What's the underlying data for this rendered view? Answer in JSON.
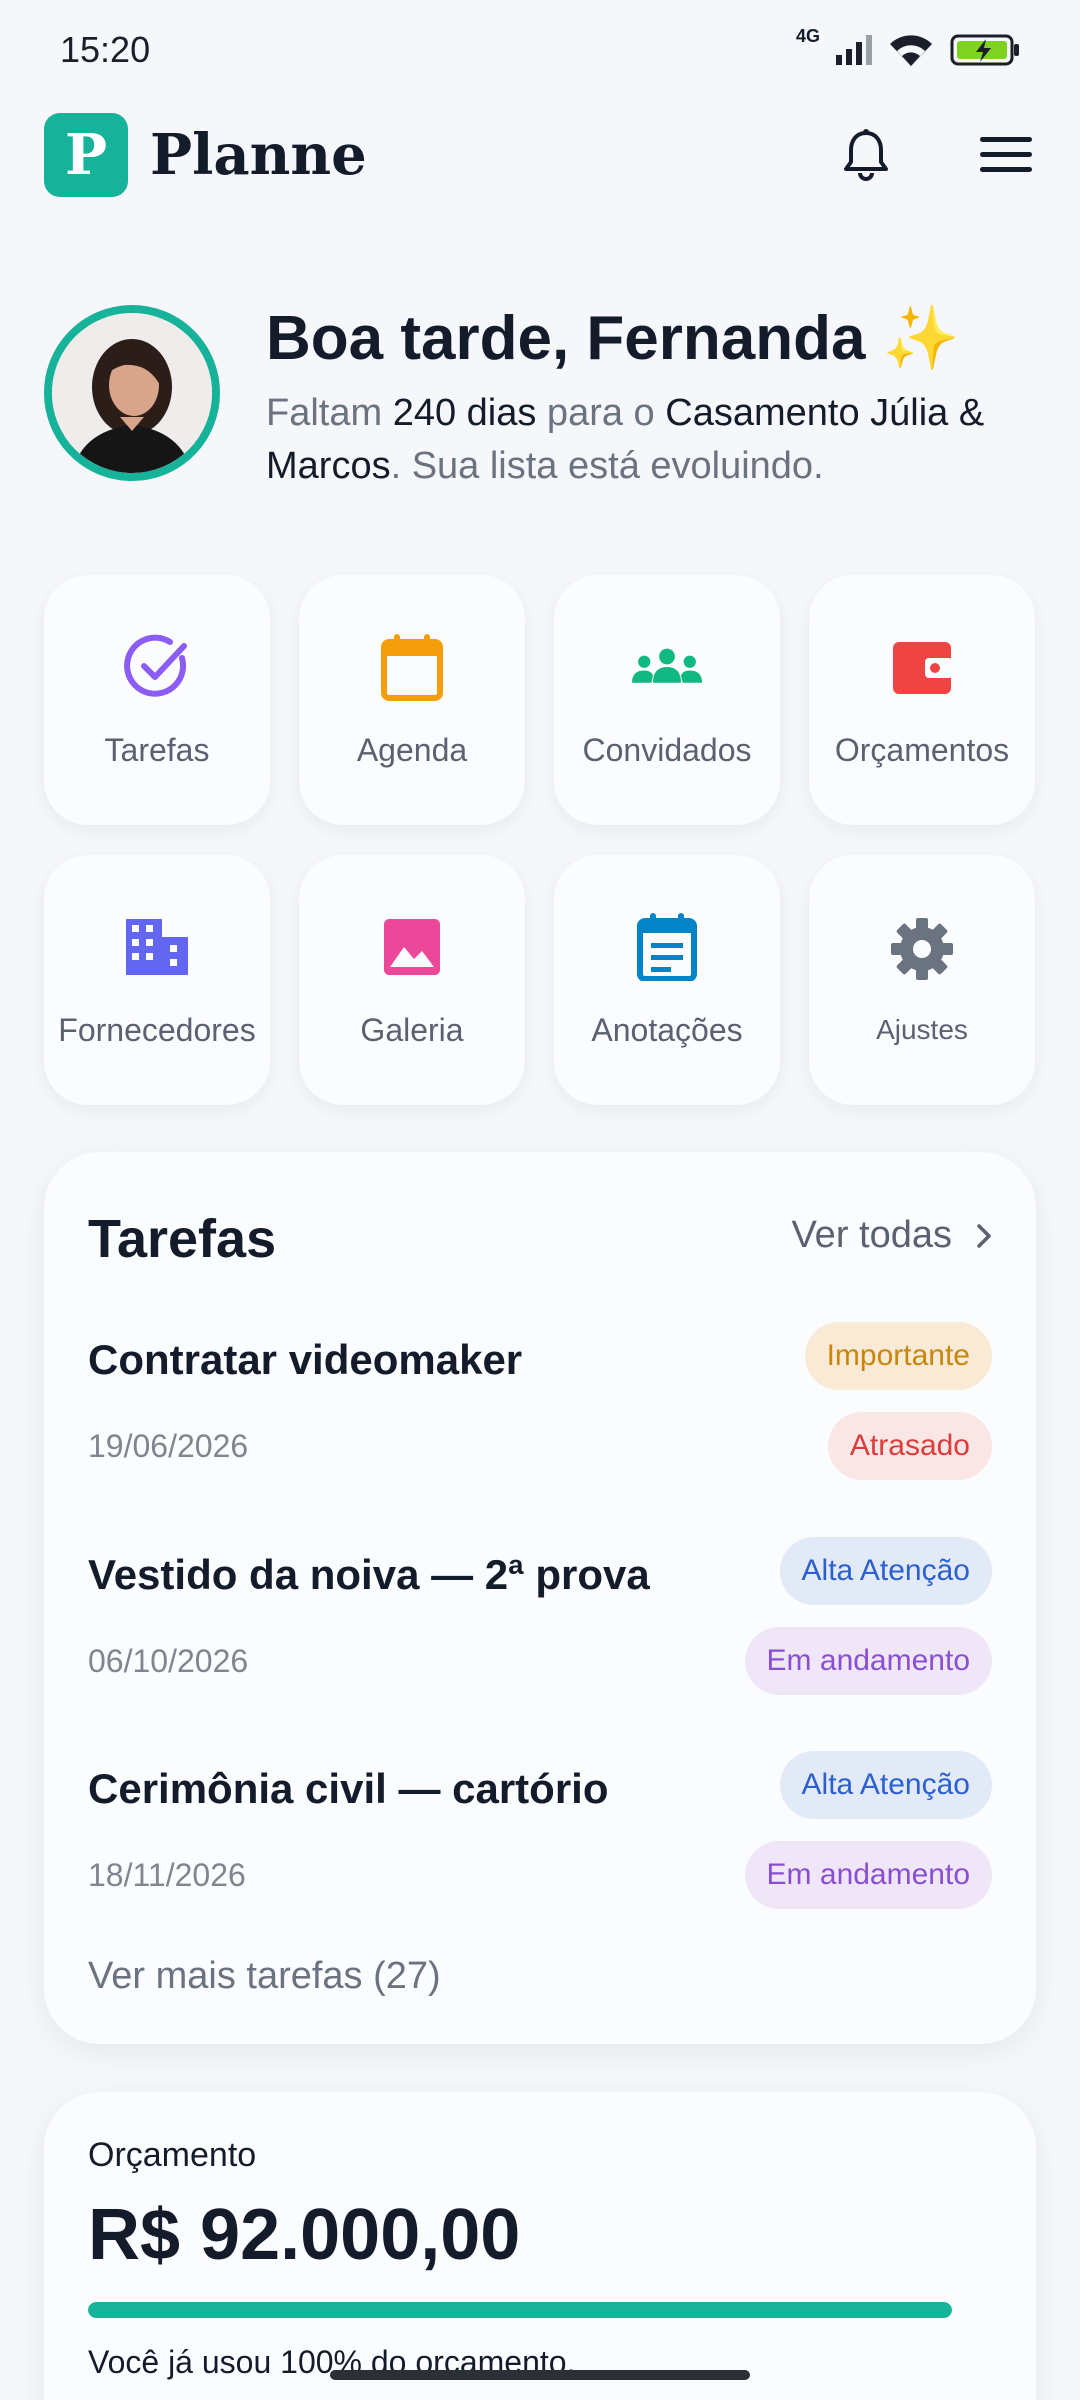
{
  "status_bar": {
    "time": "15:20",
    "network": "4G"
  },
  "app": {
    "logo_letter": "P",
    "name": "Planne"
  },
  "greeting": {
    "title": "Boa tarde, Fernanda",
    "emoji": "✨",
    "sub_prefix": "Faltam ",
    "days": "240 dias",
    "sub_middle": " para o ",
    "event": "Casamento Júlia & Marcos",
    "sub_suffix": ". Sua lista está evoluindo."
  },
  "shortcuts": [
    {
      "label": "Tarefas",
      "icon": "check-circle-icon",
      "color": "#8b5cf6"
    },
    {
      "label": "Agenda",
      "icon": "calendar-icon",
      "color": "#f59e0b"
    },
    {
      "label": "Convidados",
      "icon": "people-icon",
      "color": "#10b981"
    },
    {
      "label": "Orçamentos",
      "icon": "wallet-icon",
      "color": "#ef4444"
    },
    {
      "label": "Fornecedores",
      "icon": "building-icon",
      "color": "#6366f1"
    },
    {
      "label": "Galeria",
      "icon": "image-icon",
      "color": "#ec4899"
    },
    {
      "label": "Anotações",
      "icon": "notes-icon",
      "color": "#0284c7"
    },
    {
      "label": "Ajustes",
      "icon": "gear-icon",
      "color": "#6b7280"
    }
  ],
  "tasks_card": {
    "title": "Tarefas",
    "see_all": "Ver todas",
    "items": [
      {
        "name": "Contratar videomaker",
        "date": "19/06/2026",
        "priority": "Importante",
        "status": "Atrasado"
      },
      {
        "name": "Vestido da noiva — 2ª prova",
        "date": "06/10/2026",
        "priority": "Alta Atenção",
        "status": "Em andamento"
      },
      {
        "name": "Cerimônia civil — cartório",
        "date": "18/11/2026",
        "priority": "Alta Atenção",
        "status": "Em andamento"
      }
    ],
    "more": "Ver mais tarefas (27)"
  },
  "budget_card": {
    "label": "Orçamento",
    "value": "R$ 92.000,00",
    "used_fraction": 1.0,
    "note": "Você já usou 100% do orçamento."
  },
  "colors": {
    "brand": "#16b39a",
    "important": "#c9860f",
    "late": "#dc3c3c",
    "high_attention": "#2c5fcf",
    "in_progress": "#8a4fd0"
  }
}
